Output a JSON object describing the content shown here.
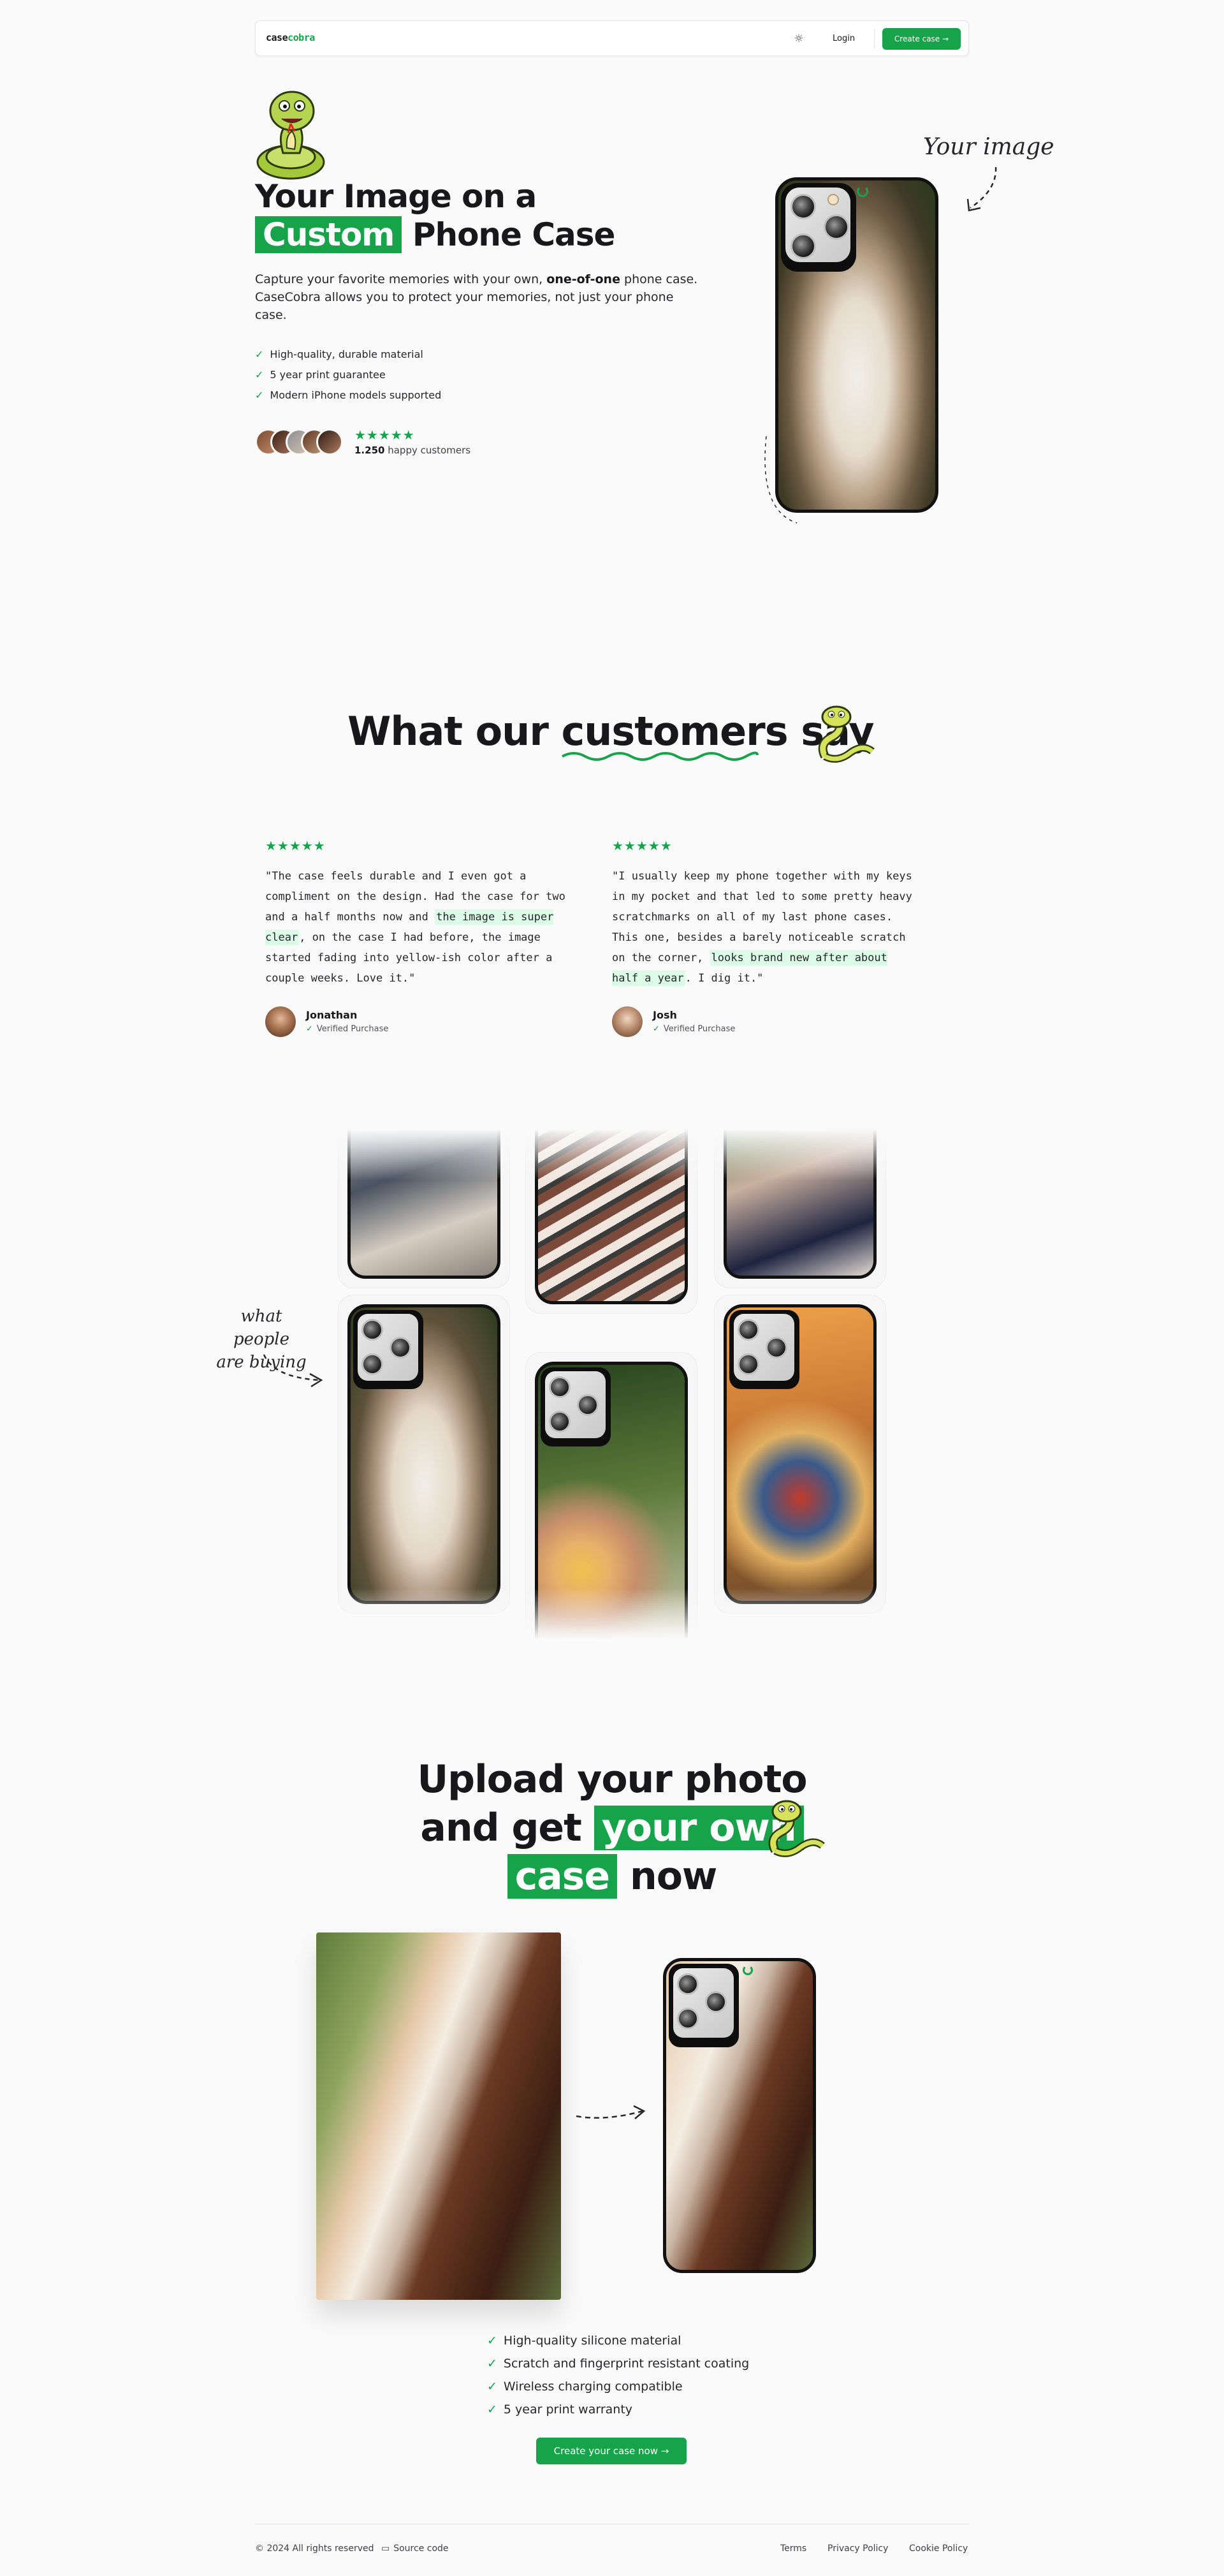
{
  "nav": {
    "logo_prefix": "case",
    "logo_accent": "cobra",
    "theme_icon": "sun-icon",
    "login": "Login",
    "create_case": "Create case",
    "create_icon": "arrow-right-icon"
  },
  "hero": {
    "title_line1": "Your Image on a",
    "title_highlight": "Custom",
    "title_rest": "Phone Case",
    "desc_start": "Capture your favorite memories with your own, ",
    "desc_bold": "one-of-one",
    "desc_end": " phone case. CaseCobra allows you to protect your memories, not just your phone case.",
    "features": [
      "High-quality, durable material",
      "5 year print guarantee",
      "Modern iPhone models supported"
    ],
    "stars": "★★★★★",
    "happy_count": "1.250",
    "happy_label": " happy customers",
    "annotation": "Your image"
  },
  "testimonials": {
    "title_start": "What our ",
    "title_emph": "customers",
    "title_end": " say",
    "items": [
      {
        "stars": "★★★★★",
        "text_start": "\"The case feels durable and I even got a compliment on the design. Had the case for two and a half months now and ",
        "text_mark": "the image is super clear",
        "text_end": ", on the case I had before, the image started fading into yellow-ish color after a couple weeks. Love it.\"",
        "name": "Jonathan",
        "verified": "Verified Purchase"
      },
      {
        "stars": "★★★★★",
        "text_start": "\"I usually keep my phone together with my keys in my pocket and that led to some pretty heavy scratchmarks on all of my last phone cases. This one, besides a barely noticeable scratch on the corner, ",
        "text_mark": "looks brand new after about half a year",
        "text_end": ". I dig it.\"",
        "name": "Josh",
        "verified": "Verified Purchase"
      }
    ]
  },
  "gallery": {
    "annotation_line1": "what people",
    "annotation_line2": "are buying"
  },
  "upload": {
    "title_line1": "Upload your photo",
    "title_line2_start": "and get ",
    "title_line2_hl": "your own",
    "title_line3_hl": "case",
    "title_line3_end": " now",
    "bullets": [
      "High-quality silicone material",
      "Scratch and fingerprint resistant coating",
      "Wireless charging compatible",
      "5 year print warranty"
    ],
    "cta": "Create your case now"
  },
  "footer": {
    "copyright": "© 2024 All rights reserved",
    "source": "Source code",
    "links": [
      "Terms",
      "Privacy Policy",
      "Cookie Policy"
    ]
  },
  "colors": {
    "accent": "#16a34a",
    "highlight_bg": "#dcfce7"
  }
}
